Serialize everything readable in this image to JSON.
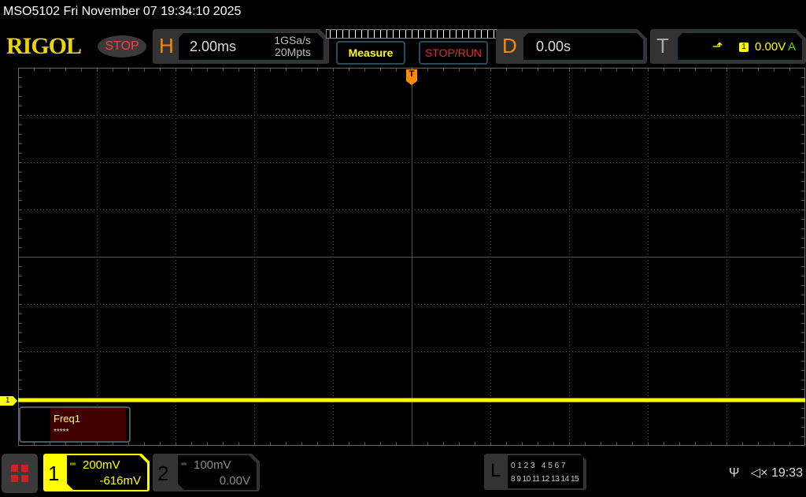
{
  "header": {
    "title": "MSO5102  Fri November 07 19:34:10 2025",
    "logo": "RIGOL",
    "run_state": "STOP"
  },
  "horizontal": {
    "letter": "H",
    "timebase": "2.00ms",
    "sample_rate": "1GSa/s",
    "memory_depth": "20Mpts"
  },
  "buttons": {
    "measure": "Measure",
    "stop_run": "STOP/RUN"
  },
  "delay": {
    "letter": "D",
    "value": "0.00s"
  },
  "trigger": {
    "letter": "T",
    "edge": "rising-edge-icon",
    "source": "1",
    "level": "0.00V",
    "mode": "A",
    "marker": "T"
  },
  "channel_marker": "1",
  "measurement": {
    "name": "Freq1",
    "value": "*****"
  },
  "channels": [
    {
      "number": "1",
      "coupling": "DC",
      "scale": "200mV",
      "offset": "-616mV",
      "color": "#ffff00"
    },
    {
      "number": "2",
      "coupling": "DC",
      "scale": "100mV",
      "offset": "0.00V",
      "color": "#888888"
    }
  ],
  "logic": {
    "letter": "L",
    "row1": "0 1 2 3   4 5 6 7",
    "row2": "8 9 10 11 12 13 14 15"
  },
  "status": {
    "usb": "usb-icon",
    "sound": "mute-icon",
    "time": "19:33"
  },
  "colors": {
    "accent": "#ff8a00",
    "trace": "#ffff00"
  }
}
